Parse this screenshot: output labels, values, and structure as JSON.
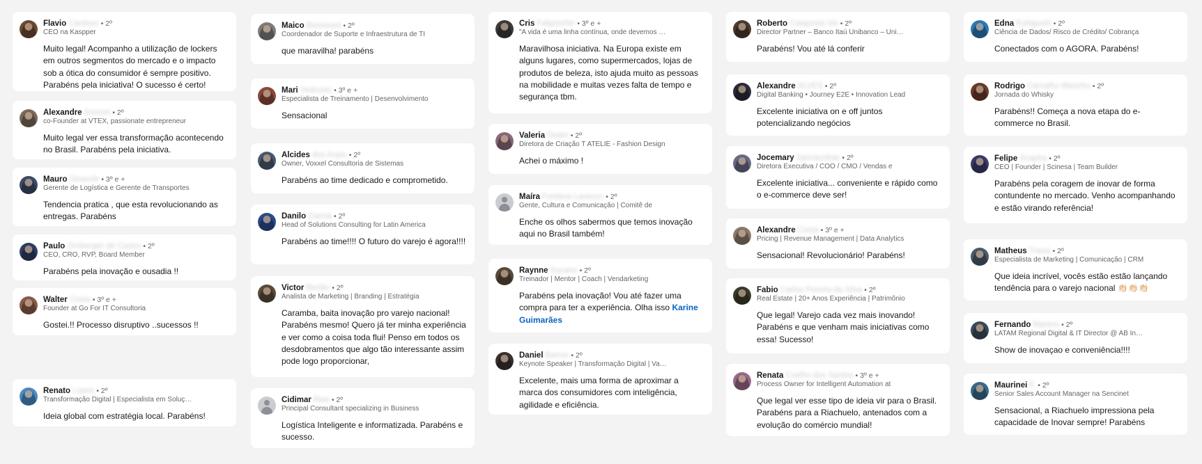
{
  "columns": [
    {
      "cards": [
        {
          "first": "Flavio",
          "surname": "Cardoso",
          "degree": "• 2º",
          "headline": "CEO na Kaspper",
          "comment": "Muito legal! Acompanho a utilização de lockers em outros segmentos do mercado e o impacto sob a ótica do consumidor é sempre positivo. Parabéns pela iniciativa! O sucesso é certo!",
          "avatar_color": "#6b4a32"
        },
        {
          "first": "Alexandre",
          "surname": "Soncini",
          "degree": "• 2º",
          "headline": "co-Founder at VTEX, passionate entrepreneur",
          "comment": "Muito legal ver essa transformação acontecendo no Brasil. Parabéns pela iniciativa.",
          "avatar_color": "#7a6a5a"
        },
        {
          "first": "Mauro",
          "surname": "Girasole",
          "degree": "• 3º e +",
          "headline": "Gerente de Logística e Gerente de Transportes",
          "comment": "Tendencia pratica , que esta revolucionando as entregas.  Parabéns",
          "avatar_color": "#3c4a66"
        },
        {
          "first": "Paulo",
          "surname": "Zirnberger de Castro",
          "degree": "• 2º",
          "headline": "CEO, CRO, RVP, Board Member",
          "comment": "Parabéns pela inovação e ousadia !!",
          "avatar_color": "#2f3d63"
        },
        {
          "first": "Walter",
          "surname": "Costa",
          "degree": "• 3º e +",
          "headline": "Founder at Go For IT Consultoria",
          "comment": "Gostei.!! Processo disruptivo ..sucessos !!",
          "avatar_color": "#8a5a4a"
        },
        {
          "first": "Renato",
          "surname": "Lopes",
          "degree": "• 2º",
          "headline": "Transformação Digital | Especialista em Soluções",
          "comment": "Ideia global com estratégia local. Parabéns!",
          "avatar_color": "#4a8cc8"
        }
      ]
    },
    {
      "cards": [
        {
          "first": "Maico",
          "surname": "Bonissoni",
          "degree": "• 2º",
          "headline": "Coordenador de Suporte e Infraestrutura de TI",
          "comment": "que maravilha! parabéns",
          "avatar_color": "#7d7d7d"
        },
        {
          "first": "Mari",
          "surname": "Vedrosto",
          "degree": "• 3º e +",
          "headline": "Especialista de Treinamento | Desenvolvimento",
          "comment": "Sensacional",
          "avatar_color": "#8a4a3a"
        },
        {
          "first": "Alcides",
          "surname": "dos Anjos",
          "degree": "• 2º",
          "headline": "Owner, Voxxel Consultoria de Sistemas",
          "comment": "Parabéns ao time dedicado e comprometido.",
          "avatar_color": "#4a5a6e"
        },
        {
          "first": "Danilo",
          "surname": "Garcia",
          "degree": "• 2º",
          "headline": "Head of Solutions Consulting for Latin America",
          "comment": "Parabéns ao time!!!! O futuro do varejo é agora!!!!",
          "avatar_color": "#2a4a8a"
        },
        {
          "first": "Victor",
          "surname": "Bertão",
          "degree": "• 2º",
          "headline": "Analista de Marketing | Branding | Estratégia",
          "comment": "Caramba, baita inovação pro varejo nacional! Parabéns mesmo! Quero já ter minha experiência e ver como a coisa toda flui! Penso em todos os desdobramentos que algo tão interessante assim pode logo proporcionar,",
          "avatar_color": "#5a4a3a"
        },
        {
          "first": "Cidimar",
          "surname": "Reis",
          "degree": "• 2º",
          "headline": "Principal Consultant specializing in Business",
          "comment": "Logística Inteligente e informatizada. Parabéns e sucesso.",
          "avatar_color": ""
        }
      ]
    },
    {
      "cards": [
        {
          "first": "Cris",
          "surname": "Falgstorfer",
          "degree": "• 3º e +",
          "headline": "\"A vida é uma linha contínua, onde devemos seguir\"",
          "comment": "Maravilhosa iniciativa. Na Europa existe em alguns lugares, como supermercados, lojas de produtos de beleza, isto ajuda muito as pessoas na mobilidade e muitas vezes falta de tempo e segurança tbm.",
          "avatar_color": "#3a3a3a"
        },
        {
          "first": "Valeria",
          "surname": "Dieter",
          "degree": "• 2º",
          "headline": "Diretora de Criação T ATELIÊ - Fashion Design",
          "comment": "Achei o máximo !",
          "avatar_color": "#8a6a7a"
        },
        {
          "first": "Maíra",
          "surname": "Fontana Lavezzo",
          "degree": "• 2º",
          "headline": "Gente, Cultura e Comunicação | Comitê de",
          "comment": "Enche os olhos sabermos que temos inovação aqui no Brasil também!",
          "avatar_color": ""
        },
        {
          "first": "Raynne",
          "surname": "Sucano",
          "degree": "• 2º",
          "headline": "Treinador | Mentor | Coach | Vendarketing",
          "comment": "Parabéns pela inovação! Vou até fazer uma compra para ter a experiência. Olha isso",
          "mention": "Karine Guimarães",
          "avatar_color": "#5a4a3a"
        },
        {
          "first": "Daniel",
          "surname": "Barros",
          "degree": "• 2º",
          "headline": "Keynote Speaker | Transformação Digital | Varejo",
          "comment": "Excelente, mais uma forma de aproximar a marca dos consumidores com inteligência, agilidade e eficiência.",
          "avatar_color": "#3a3030"
        }
      ]
    },
    {
      "cards": [
        {
          "first": "Roberto",
          "surname": "Catapreta Vei",
          "degree": "• 2º",
          "headline": "Director Partner – Banco Itaú Unibanco – Unidade",
          "comment": "Parabéns! Vou até lá conferir",
          "avatar_color": "#4a3a30"
        },
        {
          "first": "Alexandre",
          "surname": "ALVES",
          "degree": "• 2º",
          "headline": "Digital Banking • Journey E2E • Innovation Lead",
          "comment": "Excelente iniciativa on e off juntos potencializando negócios",
          "avatar_color": "#2a2a3a"
        },
        {
          "first": "Jocemary",
          "surname": "Sasnauskas",
          "degree": "• 2º",
          "headline": "Diretora Executiva / COO / CMO / Vendas e",
          "comment": "Excelente iniciativa... conveniente e rápido como o e-commerce deve ser!",
          "avatar_color": "#6a6a8a"
        },
        {
          "first": "Alexandre",
          "surname": "Costa",
          "degree": "• 3º e +",
          "headline": "Pricing | Revenue Management | Data Analytics",
          "comment": "Sensacional! Revolucionário! Parabéns!",
          "avatar_color": "#8a7a6a"
        },
        {
          "first": "Fabio",
          "surname": "Carlos Pereira da Silva",
          "degree": "• 2º",
          "headline": "Real Estate | 20+ Anos Experiência | Patrimônio",
          "comment": "Que legal! Varejo cada vez mais inovando! Parabéns e que venham mais iniciativas como essa! Sucesso!",
          "avatar_color": "#3a3a2a"
        },
        {
          "first": "Renata",
          "surname": "Coelho dos Santos",
          "degree": "• 3º e +",
          "headline": "Process Owner for Intelligent Automation at",
          "comment": "Que legal ver esse tipo de ideia vir para o Brasil. Parabéns para a Riachuelo, antenados com a evolução do comércio mundial!",
          "avatar_color": "#9a6a8a"
        }
      ]
    },
    {
      "cards": [
        {
          "first": "Edna",
          "surname": "Kuhigushi",
          "degree": "• 2º",
          "headline": "Ciência de Dados/ Risco de Crédito/ Cobrança",
          "comment": "Conectados com o AGORA. Parabéns!",
          "avatar_color": "#2a7ab8"
        },
        {
          "first": "Rodrigo",
          "surname": "Carvalho Marinho",
          "degree": "• 2º",
          "headline": "Jornada do Whisky",
          "comment": "Parabéns!! Começa a nova etapa do e-commerce no Brasil.",
          "avatar_color": "#6a3a2a"
        },
        {
          "first": "Felipe",
          "surname": "Scapha",
          "degree": "• 2º",
          "headline": "CEO | Founder | Scinesa | Team Builder",
          "comment": "Parabéns pela coragem de inovar de forma contundente no mercado. Venho acompanhando e estão virando referência!",
          "avatar_color": "#3a3a6a"
        },
        {
          "first": "Matheus",
          "surname": "Trassi",
          "degree": "• 2º",
          "headline": "Especialista de Marketing | Comunicação | CRM",
          "comment": "Que ideia incrível, vocês estão estão lançando tendência para o varejo nacional 👏🏻👏🏻👏🏻",
          "avatar_color": "#4a5a6a"
        },
        {
          "first": "Fernando",
          "surname": "Martins",
          "degree": "• 2º",
          "headline": "LATAM Regional Digital & IT Director @ AB InBev",
          "comment": "Show de inovaçao e conveniência!!!!",
          "avatar_color": "#3a4a5a"
        },
        {
          "first": "Maurinei",
          "surname": "F.",
          "degree": "• 2º",
          "headline": "Senior Sales Account Manager na Sencinet",
          "comment": "Sensacional, a Riachuelo impressiona pela capacidade de Inovar sempre! Parabéns",
          "avatar_color": "#3a6a8a"
        }
      ]
    }
  ]
}
